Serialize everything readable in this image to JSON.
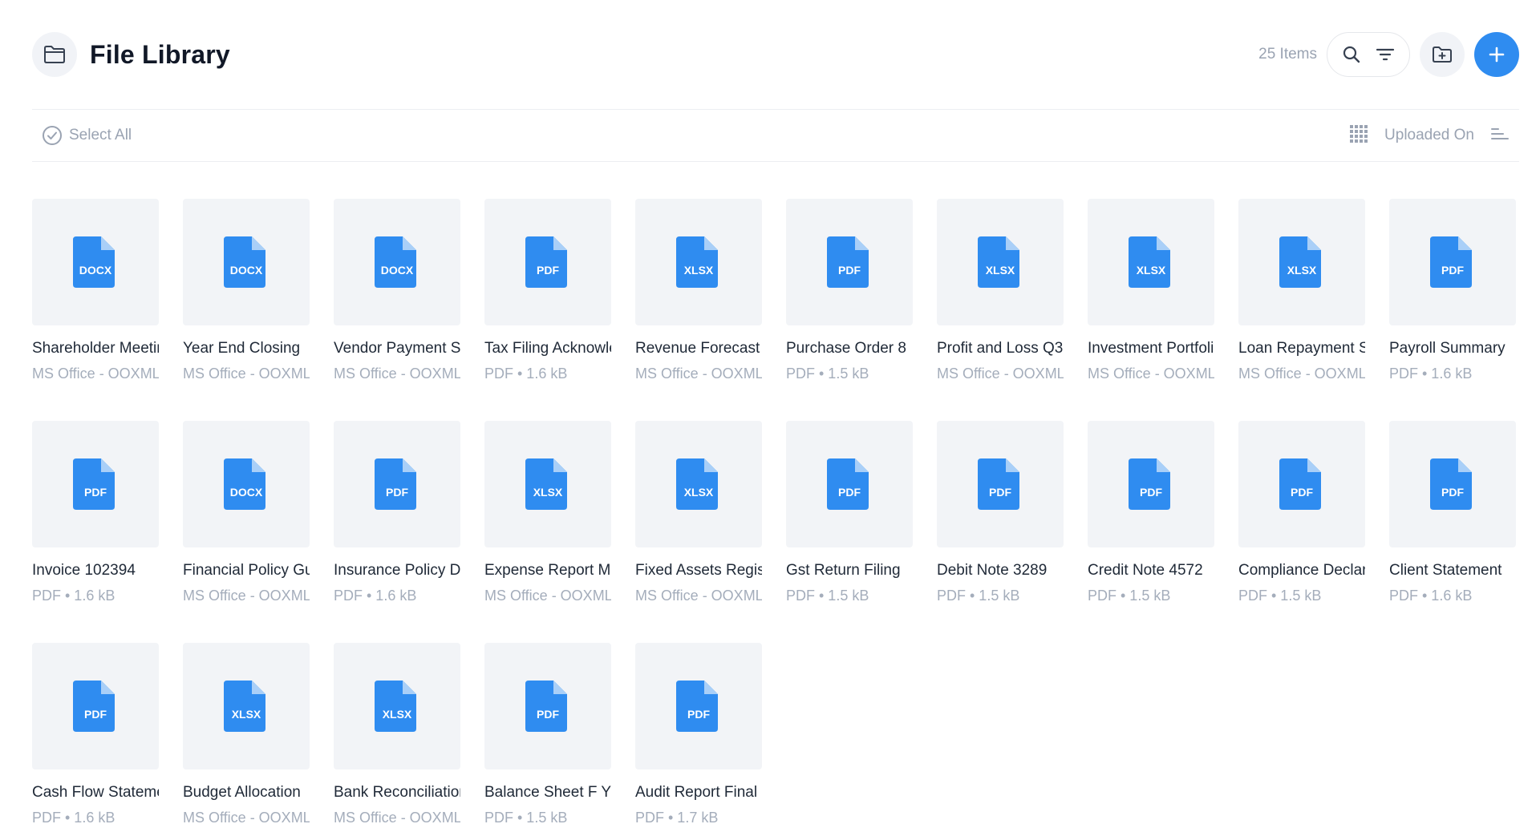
{
  "header": {
    "title": "File Library",
    "items_count": "25 Items"
  },
  "toolbar": {
    "select_all": "Select All",
    "sort_label": "Uploaded On"
  },
  "colors": {
    "accent": "#2f8cf0",
    "thumb_bg": "#f2f4f7",
    "muted_text": "#9aa3b2"
  },
  "files": [
    {
      "name": "Shareholder Meeting Minutes",
      "meta": "MS Office - OOXML",
      "type": "DOCX"
    },
    {
      "name": "Year End Closing",
      "meta": "MS Office - OOXML",
      "type": "DOCX"
    },
    {
      "name": "Vendor Payment Schedule",
      "meta": "MS Office - OOXML",
      "type": "DOCX"
    },
    {
      "name": "Tax Filing Acknowledgement",
      "meta": "PDF • 1.6 kB",
      "type": "PDF"
    },
    {
      "name": "Revenue Forecast",
      "meta": "MS Office - OOXML",
      "type": "XLSX"
    },
    {
      "name": "Purchase Order 8",
      "meta": "PDF • 1.5 kB",
      "type": "PDF"
    },
    {
      "name": "Profit and Loss Q3",
      "meta": "MS Office - OOXML",
      "type": "XLSX"
    },
    {
      "name": "Investment Portfolio",
      "meta": "MS Office - OOXML",
      "type": "XLSX"
    },
    {
      "name": "Loan Repayment Schedule",
      "meta": "MS Office - OOXML",
      "type": "XLSX"
    },
    {
      "name": "Payroll Summary",
      "meta": "PDF • 1.6 kB",
      "type": "PDF"
    },
    {
      "name": "Invoice 102394",
      "meta": "PDF • 1.6 kB",
      "type": "PDF"
    },
    {
      "name": "Financial Policy Guide",
      "meta": "MS Office - OOXML",
      "type": "DOCX"
    },
    {
      "name": "Insurance Policy Document",
      "meta": "PDF • 1.6 kB",
      "type": "PDF"
    },
    {
      "name": "Expense Report March",
      "meta": "MS Office - OOXML",
      "type": "XLSX"
    },
    {
      "name": "Fixed Assets Register",
      "meta": "MS Office - OOXML",
      "type": "XLSX"
    },
    {
      "name": "Gst Return Filing",
      "meta": "PDF • 1.5 kB",
      "type": "PDF"
    },
    {
      "name": "Debit Note 3289",
      "meta": "PDF • 1.5 kB",
      "type": "PDF"
    },
    {
      "name": "Credit Note 4572",
      "meta": "PDF • 1.5 kB",
      "type": "PDF"
    },
    {
      "name": "Compliance Declaration",
      "meta": "PDF • 1.5 kB",
      "type": "PDF"
    },
    {
      "name": "Client Statement",
      "meta": "PDF • 1.6 kB",
      "type": "PDF"
    },
    {
      "name": "Cash Flow Statement",
      "meta": "PDF • 1.6 kB",
      "type": "PDF"
    },
    {
      "name": "Budget Allocation",
      "meta": "MS Office - OOXML",
      "type": "XLSX"
    },
    {
      "name": "Bank Reconciliation",
      "meta": "MS Office - OOXML",
      "type": "XLSX"
    },
    {
      "name": "Balance Sheet F Y",
      "meta": "PDF • 1.5 kB",
      "type": "PDF"
    },
    {
      "name": "Audit Report Final",
      "meta": "PDF • 1.7 kB",
      "type": "PDF"
    }
  ]
}
